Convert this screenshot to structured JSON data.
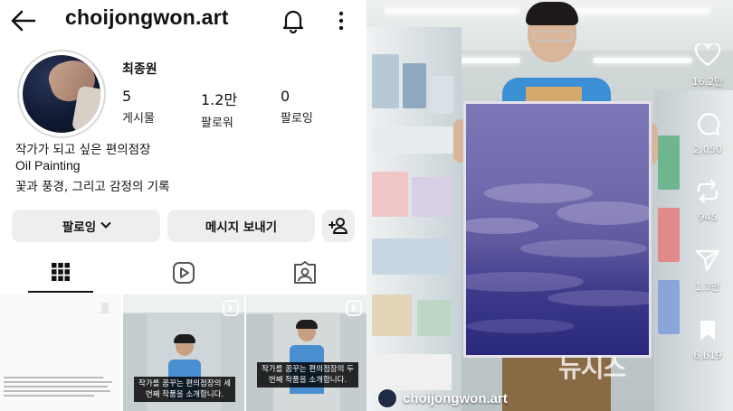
{
  "profile": {
    "username": "choijongwon.art",
    "display_name": "최종원",
    "stats": [
      {
        "value": "5",
        "label": "게시물"
      },
      {
        "value": "1.2만",
        "label": "팔로워"
      },
      {
        "value": "0",
        "label": "팔로잉"
      }
    ],
    "bio": [
      "작가가 되고 싶은 편의점장",
      "Oil Painting",
      "꽃과 풍경, 그리고 감정의 기록"
    ],
    "buttons": {
      "follow": "팔로잉",
      "message": "메시지 보내기"
    },
    "tabs": [
      "grid-icon",
      "reels-icon",
      "tagged-icon"
    ],
    "posts": [
      {
        "caption": ""
      },
      {
        "caption": "작가를 꿈꾸는 편의점장의 세번째 작품을 소개합니다."
      },
      {
        "caption": "작가를 꿈꾸는 편의점장의 두번째 작품을 소개합니다."
      }
    ]
  },
  "reel": {
    "likes": "16.2만",
    "comments": "2,050",
    "reposts": "945",
    "shares": "1.3만",
    "saves": "6,619",
    "account": "choijongwon.art",
    "watermark": "뉴시스"
  },
  "colors": {
    "vest_blue": "#3b8fd4",
    "painting_purple": "#4f4a99"
  }
}
